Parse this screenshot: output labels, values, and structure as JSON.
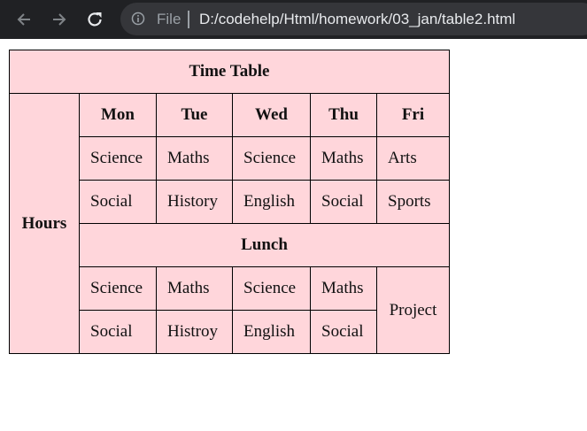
{
  "browser": {
    "file_label": "File",
    "url": "D:/codehelp/Html/homework/03_jan/table2.html"
  },
  "table": {
    "title": "Time Table",
    "row_header": "Hours",
    "days": [
      "Mon",
      "Tue",
      "Wed",
      "Thu",
      "Fri"
    ],
    "rows_before_lunch": [
      [
        "Science",
        "Maths",
        "Science",
        "Maths",
        "Arts"
      ],
      [
        "Social",
        "History",
        "English",
        "Social",
        "Sports"
      ]
    ],
    "lunch": "Lunch",
    "rows_after_lunch": [
      [
        "Science",
        "Maths",
        "Science",
        "Maths"
      ],
      [
        "Social",
        "Histroy",
        "English",
        "Social"
      ]
    ],
    "project": "Project"
  },
  "colors": {
    "table_bg": "#ffd6db",
    "toolbar_bg": "#202124",
    "address_bg": "#35363a"
  }
}
